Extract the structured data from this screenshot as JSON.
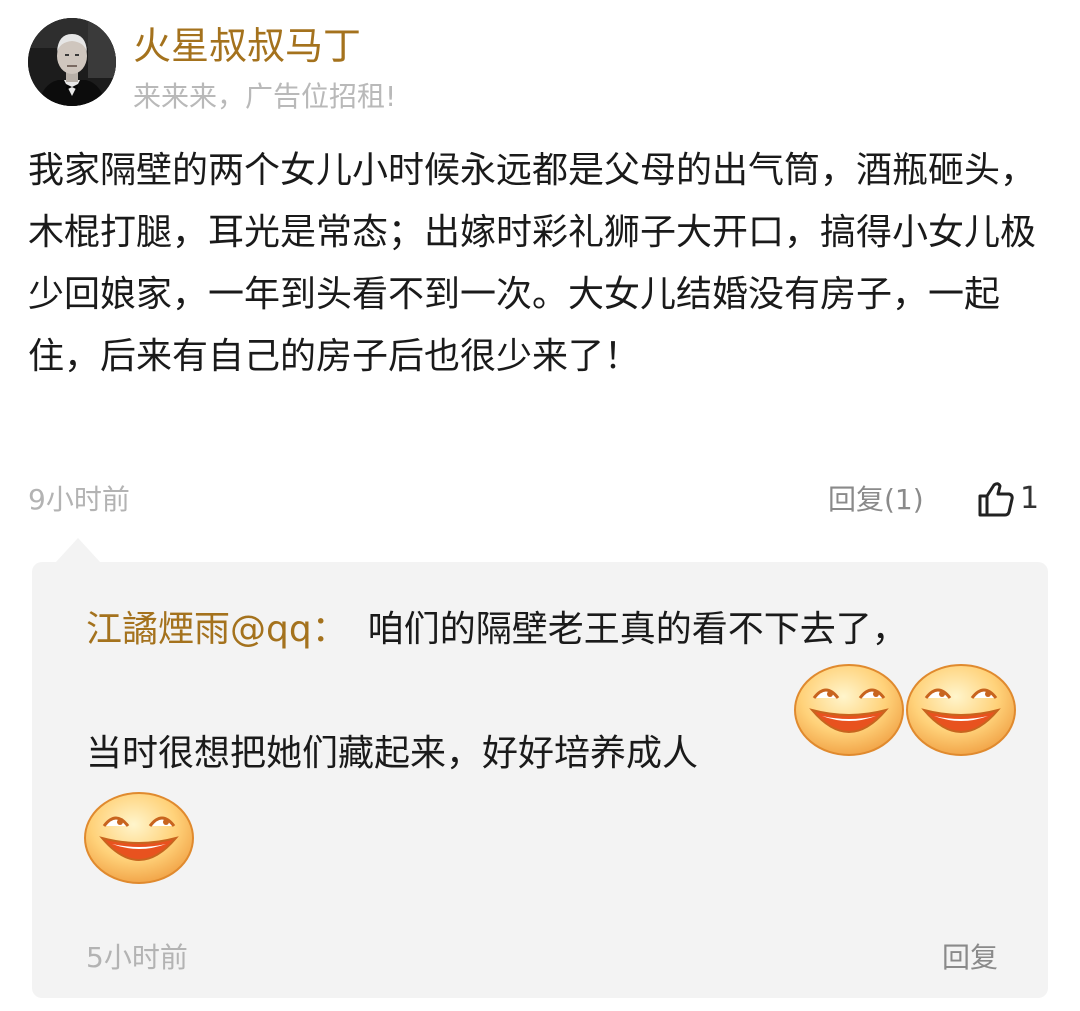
{
  "post": {
    "author_name": "火星叔叔马丁",
    "author_signature": "来来来，广告位招租!",
    "body": "我家隔壁的两个女儿小时候永远都是父母的出气筒，酒瓶砸头，木棍打腿，耳光是常态；出嫁时彩礼狮子大开口，搞得小女儿极少回娘家，一年到头看不到一次。大女儿结婚没有房子，一起住，后来有自己的房子后也很少来了！",
    "time": "9小时前",
    "reply_label": "回复(1)",
    "like_count": "1",
    "like_icon": "thumbs-up-icon"
  },
  "reply": {
    "author": "江譎煙雨@qq",
    "colon": "：",
    "text_line1": "咱们的隔壁老王真的看不下去了，",
    "text_line2": "当时很想把她们藏起来，好好培养成人",
    "emoji_icon": "laughing-face-emoji",
    "emoji_count": 3,
    "time": "5小时前",
    "reply_label": "回复"
  },
  "colors": {
    "author": "#a4721d",
    "secondary_text": "#b3b3b3",
    "reply_background": "#f3f3f3",
    "body_text": "#1a1a1a"
  }
}
